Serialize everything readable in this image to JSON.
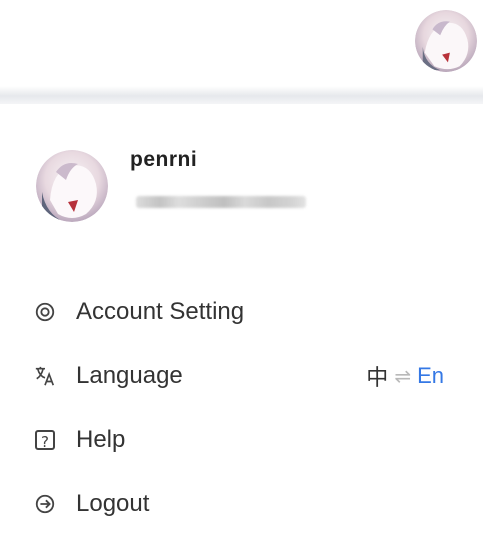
{
  "user": {
    "name": "penrni"
  },
  "menu": {
    "items": [
      {
        "label": "Account Setting",
        "icon": "settings-icon"
      },
      {
        "label": "Language",
        "icon": "translate-icon"
      },
      {
        "label": "Help",
        "icon": "help-icon"
      },
      {
        "label": "Logout",
        "icon": "logout-icon"
      }
    ]
  },
  "language_switch": {
    "left": "中",
    "swap": "⇌",
    "right": "En",
    "right_color": "#3578e5"
  }
}
